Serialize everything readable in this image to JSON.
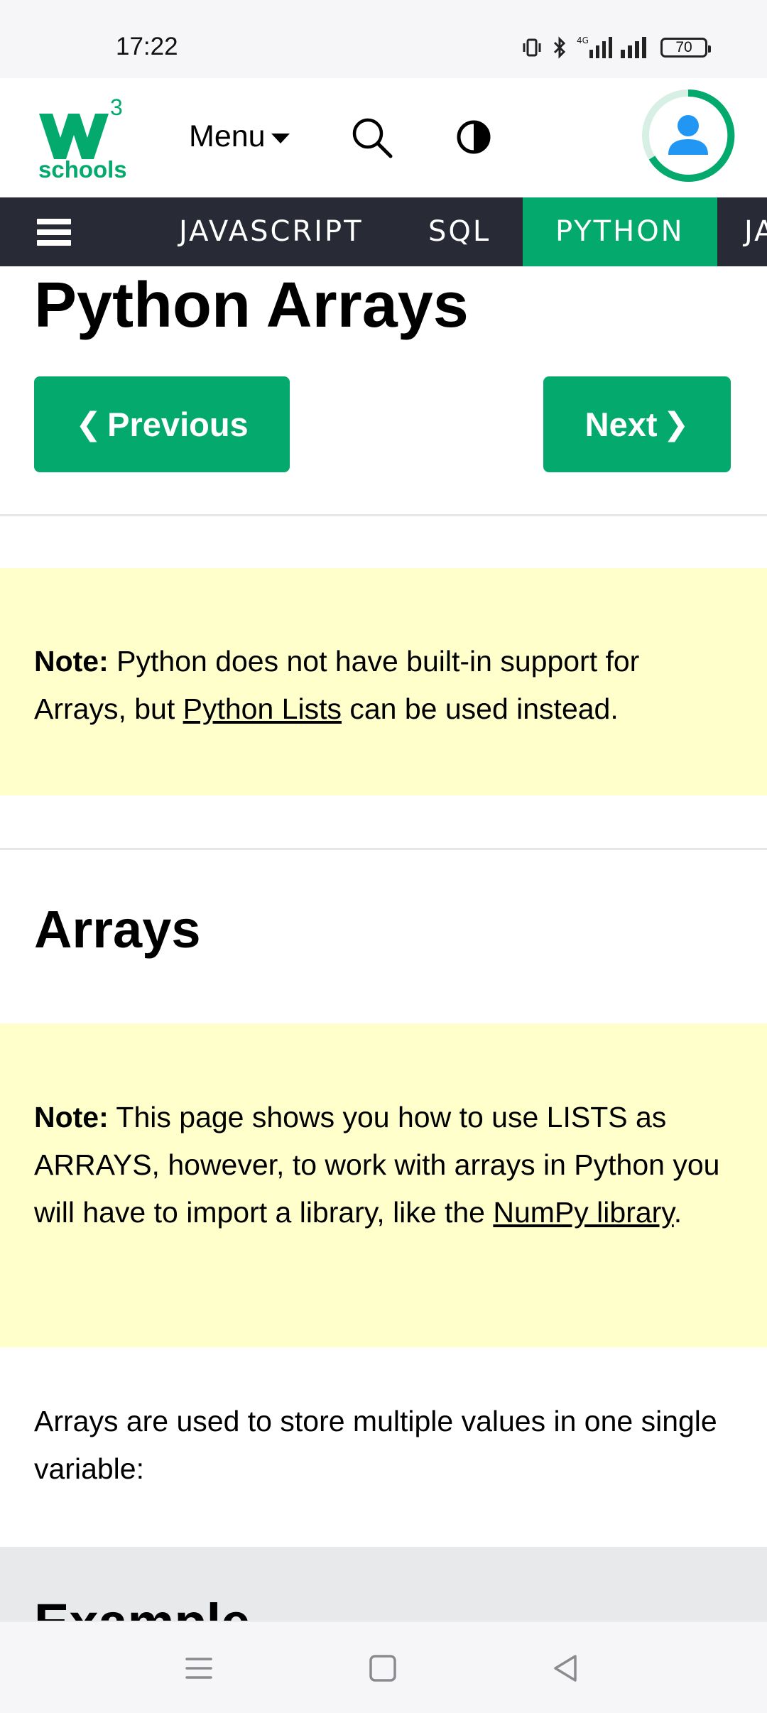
{
  "status_bar": {
    "time": "17:22",
    "network": "4G",
    "battery": "70",
    "icons": [
      "vibrate-icon",
      "bluetooth-icon",
      "signal-4g-icon",
      "signal-icon",
      "battery-icon"
    ]
  },
  "header": {
    "logo_text": "schools",
    "logo_superscript": "3",
    "menu_label": "Menu",
    "brand_color": "#04aa6d"
  },
  "tabs": [
    {
      "label": "JAVASCRIPT",
      "active": false
    },
    {
      "label": "SQL",
      "active": false
    },
    {
      "label": "PYTHON",
      "active": true
    },
    {
      "label": "JA",
      "active": false
    }
  ],
  "page": {
    "title": "Python Arrays",
    "prev_label": "Previous",
    "next_label": "Next",
    "note1": {
      "bold": "Note:",
      "text_before": " Python does not have built-in support for Arrays, but ",
      "link": "Python Lists",
      "text_after": " can be used instead."
    },
    "section_heading": "Arrays",
    "note2": {
      "bold": "Note:",
      "text_before": " This page shows you how to use LISTS as ARRAYS, however, to work with arrays in Python you will have to import a library, like the ",
      "link": "NumPy library",
      "text_after": "."
    },
    "paragraph": "Arrays are used to store multiple values in one single variable:",
    "example_heading": "Example"
  },
  "colors": {
    "nav_bg": "#282a35",
    "accent": "#04aa6d",
    "note_bg": "#ffffcc",
    "example_bg": "#e7e9eb"
  }
}
